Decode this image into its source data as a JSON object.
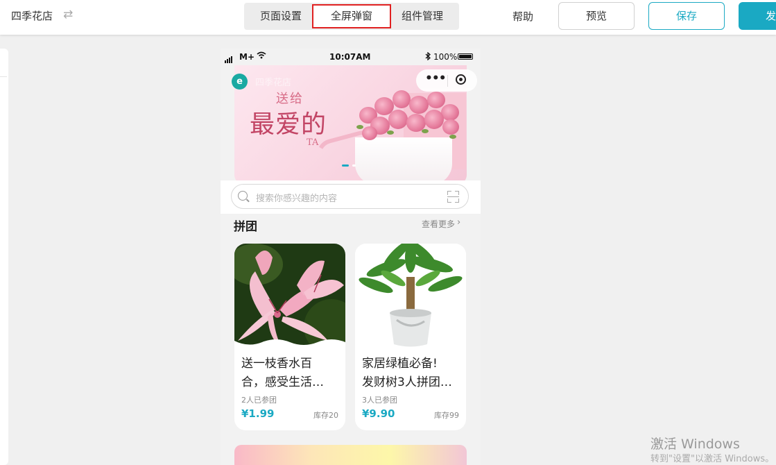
{
  "header": {
    "store_name": "四季花店",
    "tabs": [
      {
        "label": "页面设置",
        "active": false
      },
      {
        "label": "全屏弹窗",
        "active": true
      },
      {
        "label": "组件管理",
        "active": false
      }
    ],
    "help_label": "帮助",
    "preview_label": "预览",
    "save_label": "保存",
    "publish_label": "发"
  },
  "phone": {
    "status": {
      "carrier": "M+",
      "time": "10:07AM",
      "battery": "100%"
    },
    "banner": {
      "store_name": "四季花店",
      "word_small": "送给",
      "word_big": "最爱的",
      "word_ta": "TA"
    },
    "search_placeholder": "搜索你感兴趣的内容",
    "section": {
      "title": "拼团",
      "more_label": "查看更多"
    },
    "cards": [
      {
        "title_line1": "送一枝香水百",
        "title_line2": "合，感受生活…",
        "joined": "2人已参团",
        "price": "¥1.99",
        "stock": "库存20"
      },
      {
        "title_line1": "家居绿植必备!",
        "title_line2": "发财树3人拼团…",
        "joined": "3人已参团",
        "price": "¥9.90",
        "stock": "库存99"
      }
    ]
  },
  "watermark": {
    "line1": "激活 Windows",
    "line2": "转到\"设置\"以激活 Windows。"
  },
  "colors": {
    "accent": "#1aa9c3",
    "highlight_border": "#e02020",
    "price": "#1aa9c3"
  }
}
